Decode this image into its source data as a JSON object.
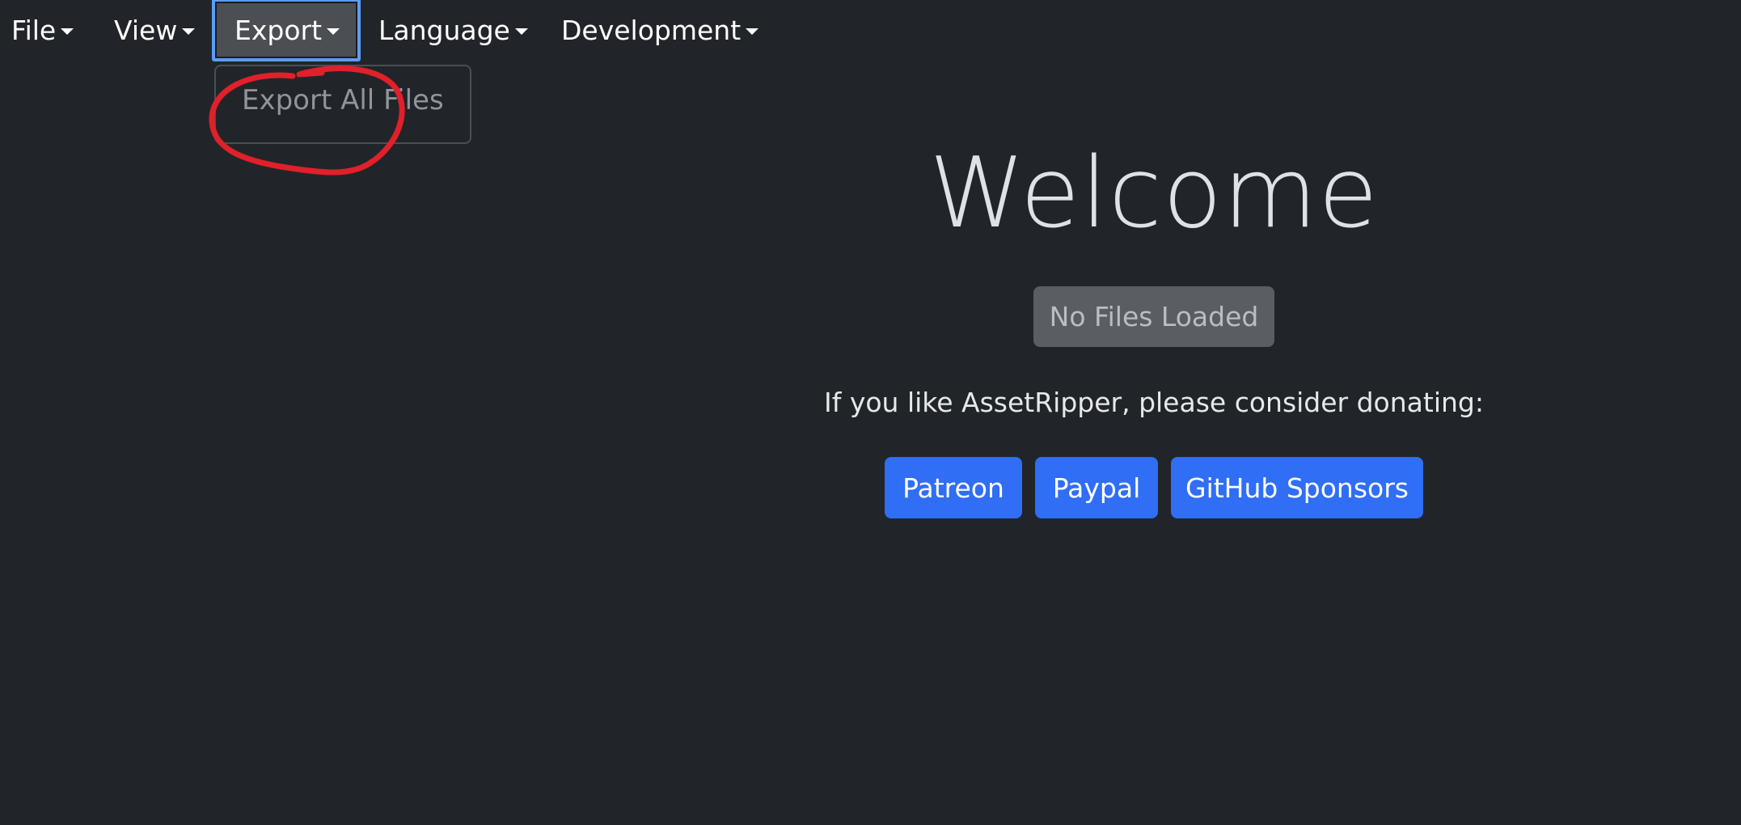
{
  "menu": {
    "file": "File",
    "view": "View",
    "export": "Export",
    "language": "Language",
    "development": "Development"
  },
  "export_dropdown": {
    "items": [
      "Export All Files"
    ]
  },
  "main": {
    "title": "Welcome",
    "status_button": "No Files Loaded",
    "donate_text": "If you like AssetRipper, please consider donating:",
    "donate_buttons": [
      "Patreon",
      "Paypal",
      "GitHub Sponsors"
    ]
  },
  "colors": {
    "background": "#212529",
    "primary": "#2f6ef5",
    "annotation": "#e0202a",
    "focus_ring": "#5b9df5"
  }
}
